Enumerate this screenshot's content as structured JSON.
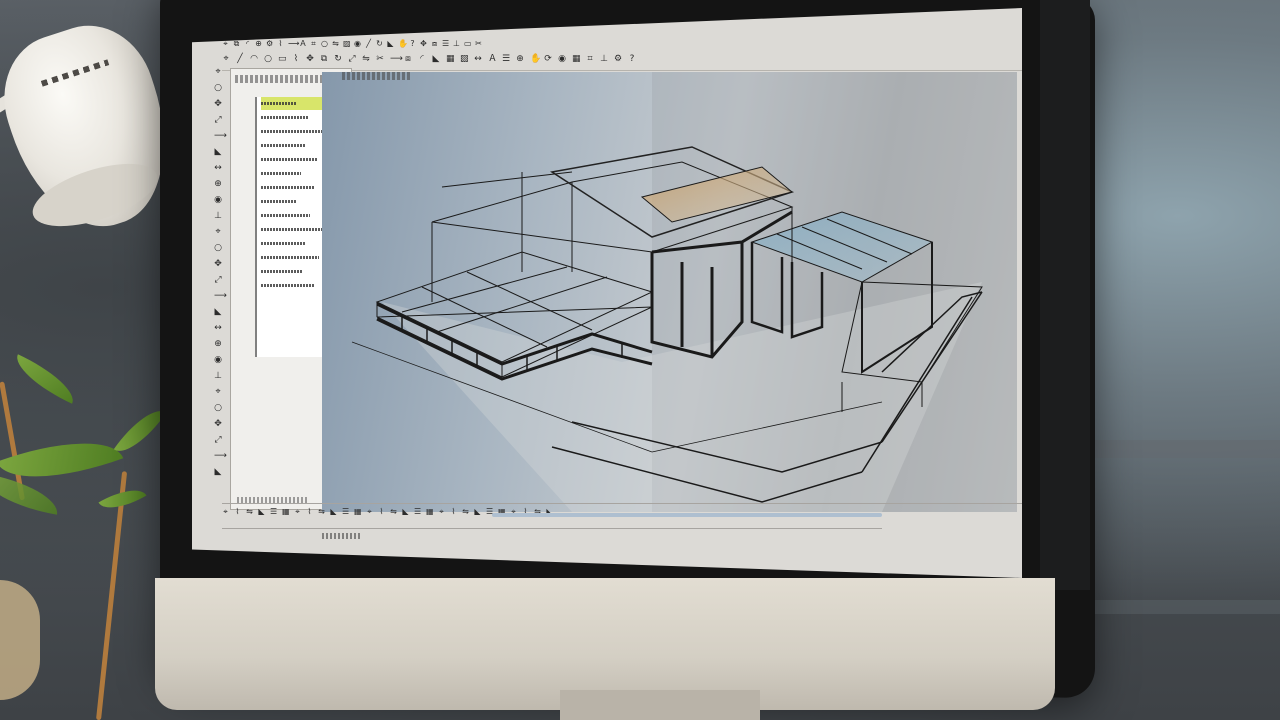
{
  "scene": {
    "description_free": true,
    "colors": {
      "viewport_left": "#8598ab",
      "viewport_right": "#c6c7c6",
      "selected_row": "#d8e56a",
      "glass_tint": "#7fa8c0",
      "floor_accent": "#c79b62",
      "monitor_chin": "#e2ddd2"
    }
  },
  "toolbar": {
    "icons": [
      "cursor-icon",
      "line-icon",
      "arc-icon",
      "circle-icon",
      "rect-icon",
      "polyline-icon",
      "move-icon",
      "copy-icon",
      "rotate-icon",
      "scale-icon",
      "mirror-icon",
      "trim-icon",
      "extend-icon",
      "offset-icon",
      "fillet-icon",
      "chamfer-icon",
      "array-icon",
      "hatch-icon",
      "dimension-icon",
      "text-icon",
      "layer-icon",
      "zoom-icon",
      "pan-icon",
      "orbit-icon",
      "render-icon",
      "grid-icon",
      "snap-icon",
      "ortho-icon",
      "settings-icon",
      "help-icon"
    ]
  },
  "left_tools": {
    "icons": [
      "select-tool-icon",
      "line-tool-icon",
      "arc-tool-icon",
      "circle-tool-icon",
      "rect-tool-icon",
      "polygon-tool-icon",
      "spline-tool-icon",
      "wall-tool-icon",
      "door-tool-icon",
      "window-tool-icon",
      "stair-tool-icon",
      "roof-tool-icon",
      "slab-tool-icon",
      "column-tool-icon",
      "beam-tool-icon",
      "dim-tool-icon",
      "text-tool-icon",
      "hatch-tool-icon",
      "measure-tool-icon",
      "erase-tool-icon",
      "undo-tool-icon",
      "redo-tool-icon",
      "zoom-tool-icon",
      "layers-tool-icon",
      "properties-tool-icon",
      "snap-tool-icon"
    ]
  },
  "panel": {
    "rows": 14,
    "selected_index": 0
  }
}
